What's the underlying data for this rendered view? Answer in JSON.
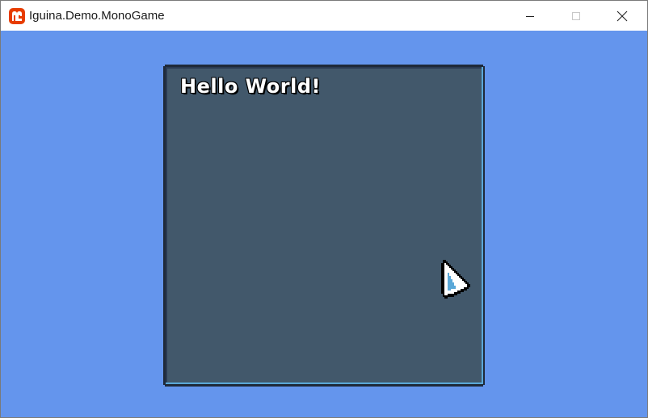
{
  "window": {
    "title": "Iguina.Demo.MonoGame",
    "app_icon": "monogame-logo-icon",
    "controls": {
      "minimize_icon": "minimize-icon",
      "maximize_icon": "maximize-icon",
      "close_icon": "close-icon"
    }
  },
  "scene": {
    "background_color": "#6495ed",
    "panel": {
      "fill_color": "#42586b",
      "border_dark": "#1f2a3a",
      "border_light": "#5aa8d8",
      "label": "Hello World!"
    },
    "cursor_icon": "pixel-arrow-cursor-icon"
  }
}
